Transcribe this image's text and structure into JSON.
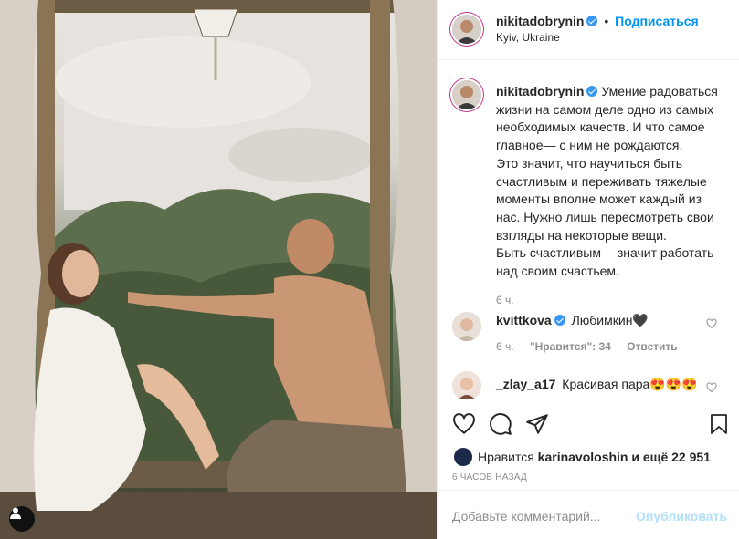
{
  "post": {
    "author": "nikitadobrynin",
    "follow_label": "Подписаться",
    "location": "Kyiv, Ukraine",
    "caption": "Умение радоваться жизни на самом деле одно из самых необходимых качеств. И что самое главное— с ним не рождаются.\nЭто значит, что научиться быть счастливым и переживать тяжелые моменты вполне может каждый из нас. Нужно лишь пересмотреть свои взгляды на некоторые вещи.\nБыть счастливым— значит работать над своим счастьем.",
    "caption_time": "6 ч."
  },
  "comments": [
    {
      "user": "kvittkova",
      "verified": true,
      "text": "Любимкин🖤",
      "time": "6 ч.",
      "likes": "\"Нравится\": 34",
      "reply": "Ответить"
    },
    {
      "user": "_zlay_a17",
      "verified": false,
      "text": "Красивая пара😍😍😍"
    }
  ],
  "likes": {
    "prefix": "Нравится",
    "user": "karinavoloshin",
    "suffix": "и ещё 22 951"
  },
  "post_time": "6 ЧАСОВ НАЗАД",
  "add_comment": {
    "placeholder": "Добавьте комментарий...",
    "publish_label": "Опубликовать"
  },
  "icons": {
    "like": "heart-icon",
    "comment": "comment-icon",
    "share": "share-icon",
    "save": "bookmark-icon",
    "tagged": "user-tag-icon"
  },
  "colors": {
    "accent": "#0095f6",
    "verified": "#3897f0",
    "muted": "#8e8e8e",
    "publish_disabled": "#b2dffc"
  }
}
